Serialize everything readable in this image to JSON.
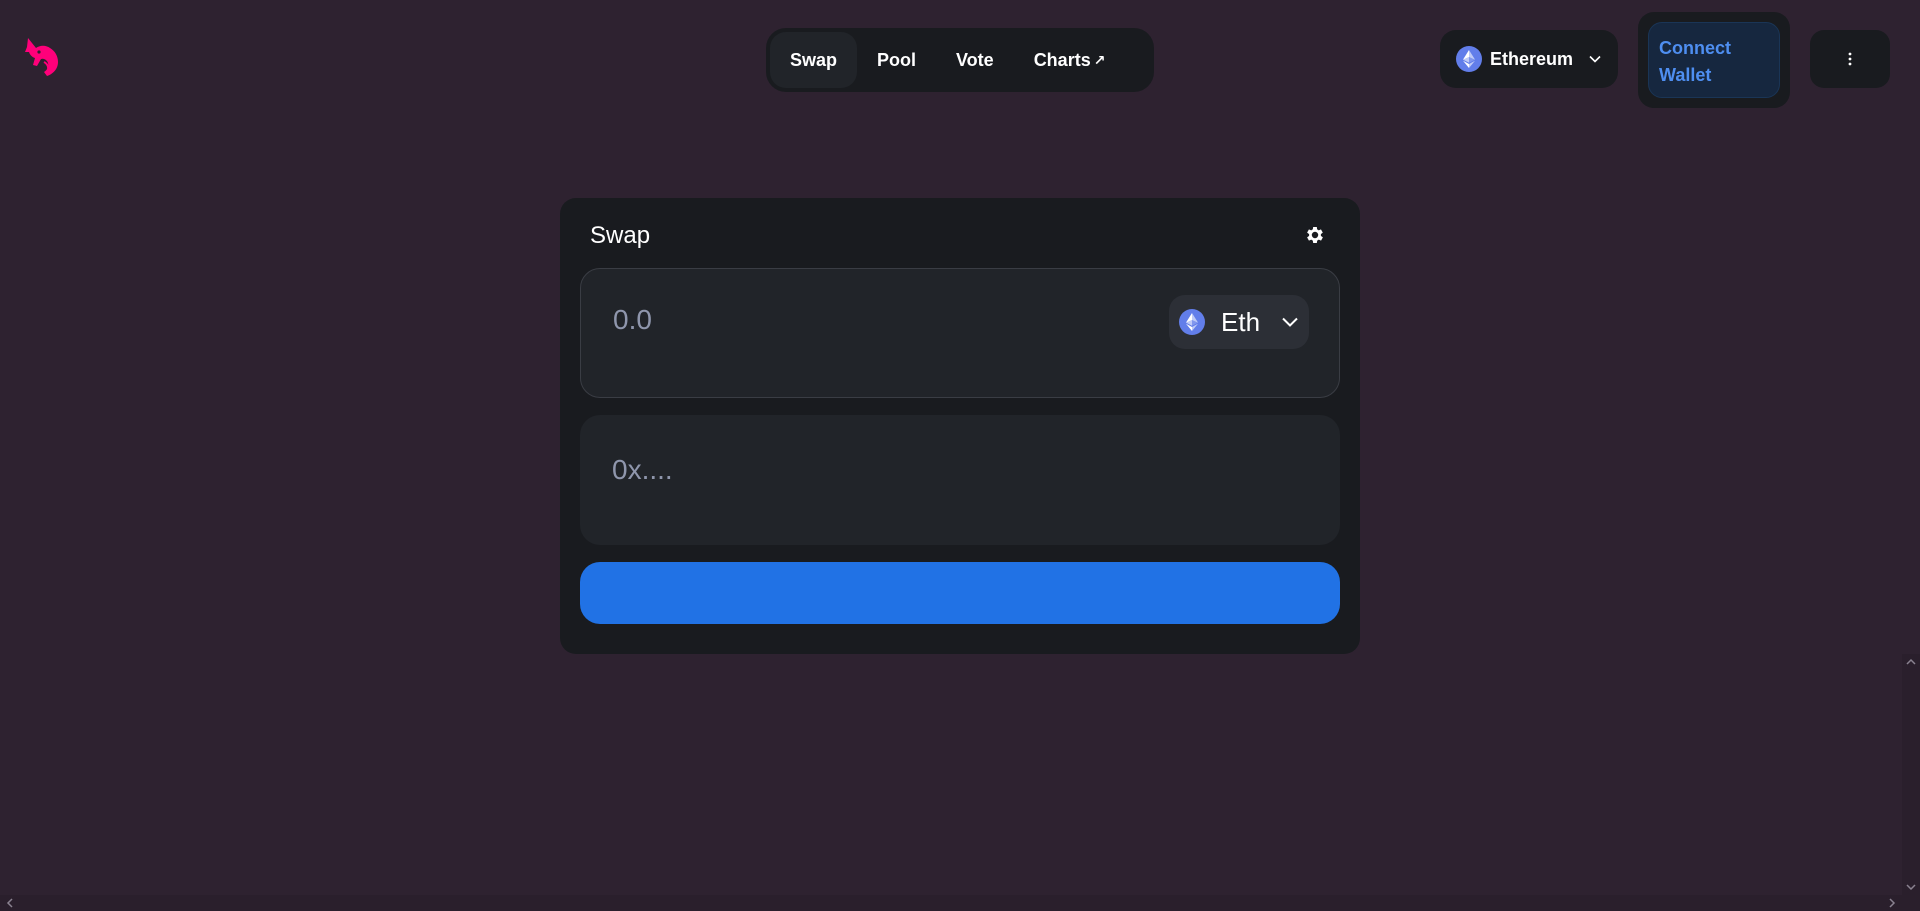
{
  "header": {
    "logo_icon": "uniswap-unicorn-icon",
    "nav": [
      {
        "label": "Swap",
        "active": true
      },
      {
        "label": "Pool",
        "active": false
      },
      {
        "label": "Vote",
        "active": false
      },
      {
        "label": "Charts",
        "active": false,
        "external_icon": "↗"
      }
    ],
    "network": {
      "label": "Ethereum",
      "icon": "ethereum-icon"
    },
    "connect_wallet": {
      "label": "Connect Wallet"
    },
    "more_icon": "kebab-menu-icon"
  },
  "swap_card": {
    "title": "Swap",
    "settings_icon": "gear-icon",
    "amount": {
      "value": "",
      "placeholder": "0.0"
    },
    "token": {
      "label": "Eth",
      "icon": "ethereum-icon"
    },
    "address": {
      "value": "",
      "placeholder": "0x...."
    },
    "action_button": {
      "label": ""
    }
  },
  "colors": {
    "background": "#2e2230",
    "panel": "#191b1f",
    "input": "#212429",
    "accent": "#2172e5",
    "brand": "#ff007a",
    "connect_text": "#4e8ef0"
  }
}
